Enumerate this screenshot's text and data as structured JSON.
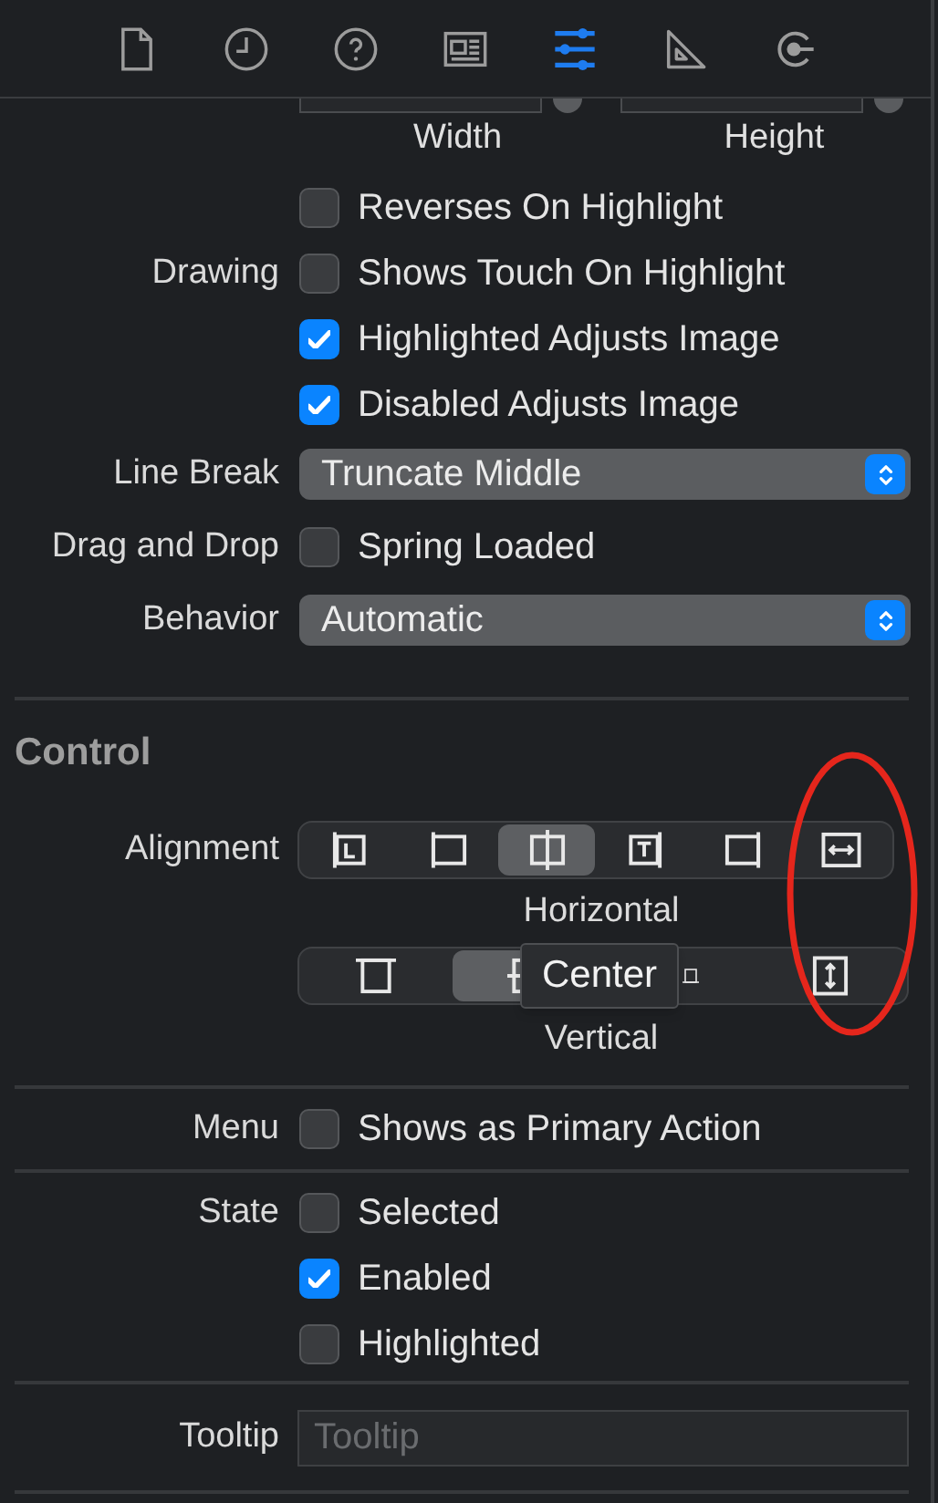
{
  "inspector_tabs": [
    {
      "kind": "file",
      "selected": false
    },
    {
      "kind": "history",
      "selected": false
    },
    {
      "kind": "help",
      "selected": false
    },
    {
      "kind": "identity",
      "selected": false
    },
    {
      "kind": "attributes",
      "selected": true
    },
    {
      "kind": "size",
      "selected": false
    },
    {
      "kind": "connections",
      "selected": false
    }
  ],
  "size_captions": [
    "Width",
    "Height"
  ],
  "button_rows": [
    {
      "kind": "checkbox",
      "text": "Reverses On Highlight",
      "checked": false
    },
    {
      "kind": "checkbox",
      "label": "Drawing",
      "text": "Shows Touch On Highlight",
      "checked": false
    },
    {
      "kind": "checkbox",
      "text": "Highlighted Adjusts Image",
      "checked": true
    },
    {
      "kind": "checkbox",
      "text": "Disabled Adjusts Image",
      "checked": true
    },
    {
      "kind": "popup",
      "label": "Line Break",
      "value": "Truncate Middle"
    },
    {
      "kind": "checkbox",
      "label": "Drag and Drop",
      "text": "Spring Loaded",
      "checked": false
    },
    {
      "kind": "popup",
      "label": "Behavior",
      "value": "Automatic"
    }
  ],
  "control": {
    "title": "Control",
    "alignment_label": "Alignment",
    "horizontal": {
      "caption": "Horizontal",
      "segments": [
        {
          "kind": "leading",
          "selected": false
        },
        {
          "kind": "left",
          "selected": false
        },
        {
          "kind": "center",
          "selected": true
        },
        {
          "kind": "trailing",
          "selected": false
        },
        {
          "kind": "right",
          "selected": false
        },
        {
          "kind": "fill",
          "selected": false
        }
      ]
    },
    "vertical": {
      "caption": "Vertical",
      "segments": [
        {
          "kind": "top",
          "selected": false
        },
        {
          "kind": "center",
          "selected": true
        },
        {
          "kind": "bottom",
          "selected": false
        },
        {
          "kind": "fill",
          "selected": false
        }
      ]
    },
    "hover_tooltip": "Center"
  },
  "menu_row": {
    "label": "Menu",
    "text": "Shows as Primary Action",
    "checked": false
  },
  "state_rows": [
    {
      "label": "State",
      "text": "Selected",
      "checked": false
    },
    {
      "text": "Enabled",
      "checked": true
    },
    {
      "text": "Highlighted",
      "checked": false
    }
  ],
  "tooltip_field": {
    "label": "Tooltip",
    "placeholder": "Tooltip"
  }
}
